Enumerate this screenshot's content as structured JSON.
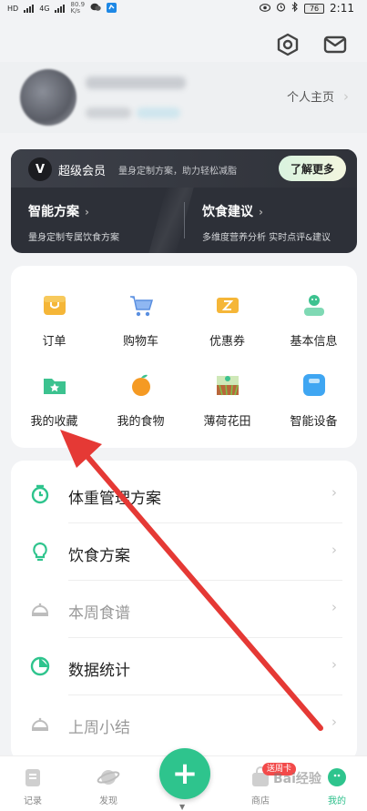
{
  "status_bar": {
    "left_labels": [
      "HD",
      "4G",
      "HD",
      "4G"
    ],
    "net_speed": "80.9",
    "net_unit": "K/s",
    "battery": "76",
    "time": "2:11"
  },
  "profile": {
    "homepage_link": "个人主页"
  },
  "vip": {
    "logo": "V",
    "title": "超级会员",
    "subtitle": "量身定制方案，助力轻松减脂",
    "more_button": "了解更多",
    "left_title": "智能方案",
    "left_desc": "量身定制专属饮食方案",
    "right_title": "饮食建议",
    "right_desc": "多维度营养分析 实时点评&建议"
  },
  "grid": [
    {
      "label": "订单",
      "icon": "order-icon"
    },
    {
      "label": "购物车",
      "icon": "shopping-cart-icon"
    },
    {
      "label": "优惠券",
      "icon": "coupon-icon"
    },
    {
      "label": "基本信息",
      "icon": "basic-info-icon"
    },
    {
      "label": "我的收藏",
      "icon": "favorites-folder-icon"
    },
    {
      "label": "我的食物",
      "icon": "orange-fruit-icon"
    },
    {
      "label": "薄荷花田",
      "icon": "farm-field-icon"
    },
    {
      "label": "智能设备",
      "icon": "smart-scale-icon"
    }
  ],
  "list": [
    {
      "label": "体重管理方案",
      "icon": "alarm-clock-icon",
      "dim": false
    },
    {
      "label": "饮食方案",
      "icon": "lightbulb-icon",
      "dim": false
    },
    {
      "label": "本周食谱",
      "icon": "cloche-icon",
      "dim": true
    },
    {
      "label": "数据统计",
      "icon": "pie-chart-icon",
      "dim": false
    },
    {
      "label": "上周小结",
      "icon": "cloche-icon",
      "dim": true
    }
  ],
  "tabbar": {
    "record": "记录",
    "discover": "发现",
    "add": "+",
    "shop": "商店",
    "shop_badge": "送周卡",
    "mine": "我的"
  },
  "watermark": "Bai经验",
  "colors": {
    "accent": "#2ec48d",
    "vip_bg": "#2d3038",
    "annotation_arrow": "#e53935"
  }
}
